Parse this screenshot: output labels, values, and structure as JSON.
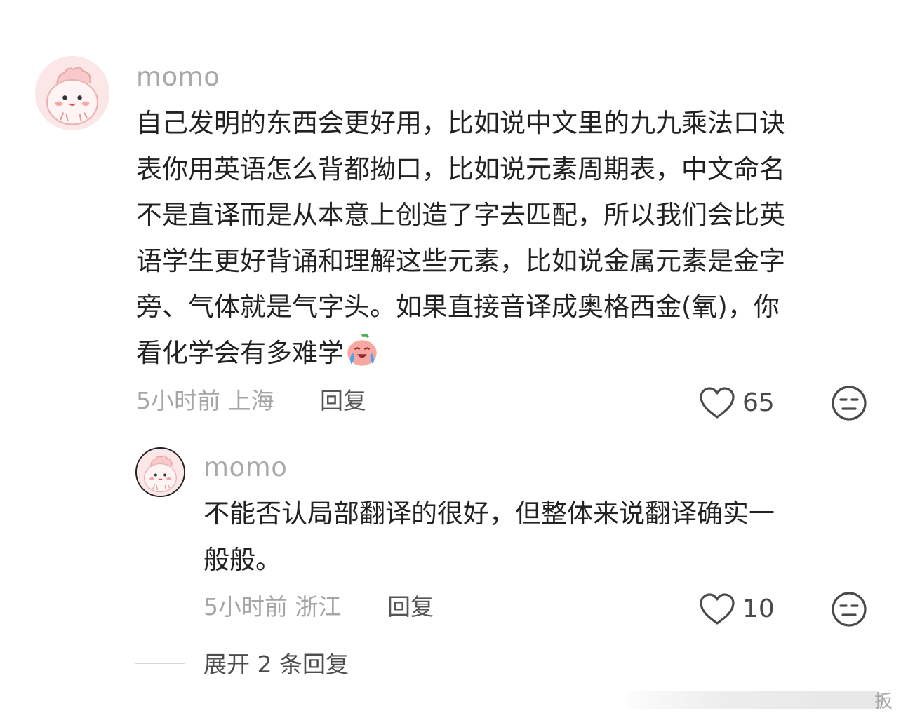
{
  "comment": {
    "username": "momo",
    "text_lines": [
      "自己发明的东西会更好用，比如说中文里的九九乘法口诀",
      "表你用英语怎么背都拗口，比如说元素周期表，中文命名",
      "不是直译而是从本意上创造了字去匹配，所以我们会比英",
      "语学生更好背诵和理解这些元素，比如说金属元素是金字",
      "旁、气体就是气字头。如果直接音译成奥格西金(氧)，你",
      "看化学会有多难学"
    ],
    "emoji": "crying-laughing-peach-emoji",
    "meta": "5小时前 上海",
    "reply_label": "回复",
    "like_count": "65"
  },
  "reply": {
    "username": "momo",
    "text_lines": [
      "不能否认局部翻译的很好，但整体来说翻译确实一",
      "般般。"
    ],
    "meta": "5小时前 浙江",
    "reply_label": "回复",
    "like_count": "10"
  },
  "expand": {
    "label": "展开 2 条回复"
  },
  "watermark": {
    "text": "扳"
  },
  "colors": {
    "avatar_bg": "#fbe6e6",
    "secondary_text": "#a6a6a6",
    "primary_text": "#222222"
  },
  "icons": {
    "like": "heart-outline-icon",
    "dislike": "meh-face-icon"
  }
}
